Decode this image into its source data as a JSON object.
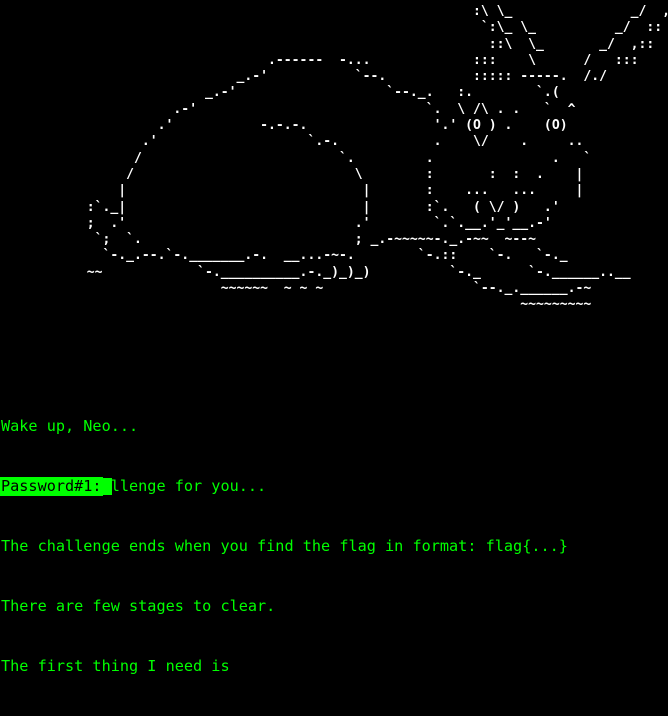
{
  "ascii_art": "                                                            :\\ \\_               _/  ,\n                                                             `:\\_ \\_          _/  ::\n                                                              ::\\  \\_       _/  ,::\n                                  .------  -...             :::    \\      /   :::\n                              _.-'           `--.           ::::: -----.  /./\n                          _.-'                   `--._.   :.        `.( \n                      .-'                             `.  \\ /\\ . .   `  ^\n                    .'           -.-.-.                '.' (O ) .    (O)\n                  .'                   `.-.            .    \\/    .     ..\n                 /                         `.         .               .   `\n                /                            \\        :       :  :  .    |\n               |                              |       :    ...   ...     |\n           :`._|                              |       :`.   ( \\/ )   .'\n           ;  .'                             .'        `.`.__.'_'__.-'\n            `;  `.                           ; _.-~~~~~-._.-~~  ~--~\n             `-._.--.`-._______.-.  __...-~-.        `-.::    `-.   `-._\n           ~~            `-.__________.-._)_)_)          `-._      `-.______..__\n                            ~~~~~~  ~ ~ ~                   `--._.______.-~\n                                                                  ~~~~~~~~~",
  "messages": [
    "Wake up, Neo...",
    "I have a challenge for you...",
    "The challenge ends when you find the flag in format: flag{...}",
    "There are few stages to clear.",
    "The first thing I need is"
  ],
  "prompt": {
    "label": "Password#1:",
    "value": ""
  },
  "colors": {
    "background": "#000000",
    "art": "#ffffff",
    "text": "#00ff00",
    "prompt_bg": "#00ff00",
    "prompt_fg": "#000000"
  }
}
